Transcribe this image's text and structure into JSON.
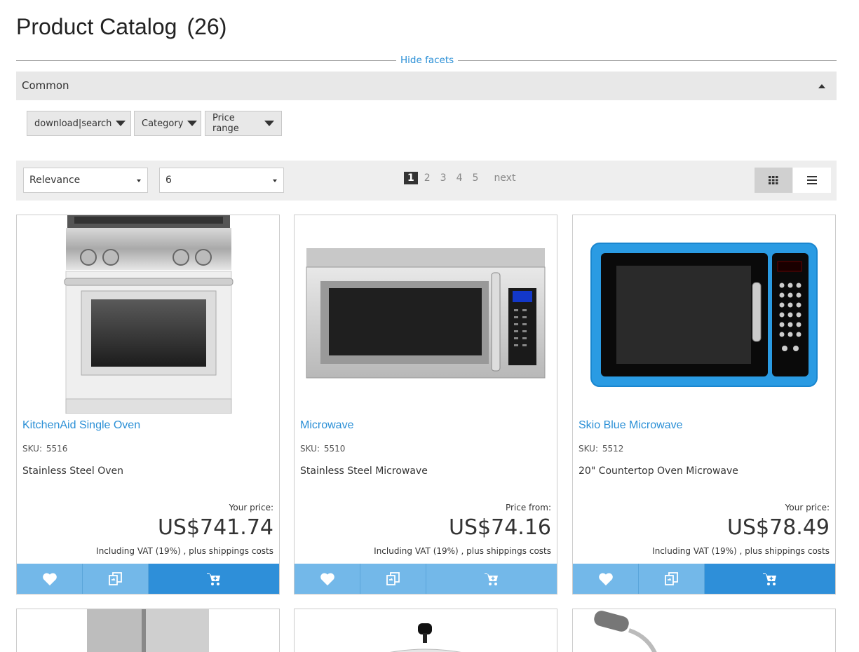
{
  "header": {
    "title": "Product Catalog",
    "count": "(26)"
  },
  "facets": {
    "toggle_label": "Hide facets",
    "group_label": "Common",
    "buttons": [
      "download|search",
      "Category",
      "Price range"
    ]
  },
  "toolbar": {
    "sort_value": "Relevance",
    "per_page_value": "6",
    "pages": [
      "1",
      "2",
      "3",
      "4",
      "5"
    ],
    "next_label": "next",
    "current_page": "1"
  },
  "products": [
    {
      "name": "KitchenAid Single Oven",
      "sku_label": "SKU:",
      "sku": "5516",
      "description": "Stainless Steel Oven",
      "price_label": "Your price:",
      "price": "US$741.74",
      "vat": "Including VAT (19%) , plus shippings costs",
      "image": "oven-image"
    },
    {
      "name": "Microwave",
      "sku_label": "SKU:",
      "sku": "5510",
      "description": "Stainless Steel Microwave",
      "price_label": "Price from:",
      "price": "US$74.16",
      "vat": "Including VAT (19%) , plus shippings costs",
      "image": "microwave-image"
    },
    {
      "name": "Skio Blue Microwave",
      "sku_label": "SKU:",
      "sku": "5512",
      "description": "20\" Countertop Oven Microwave",
      "price_label": "Your price:",
      "price": "US$78.49",
      "vat": "Including VAT (19%) , plus shippings costs",
      "image": "blue-microwave-image"
    }
  ],
  "icons": {
    "favorite": "heart-icon",
    "compare": "compare-icon",
    "cart": "add-to-cart-icon",
    "grid_view": "grid-view-icon",
    "list_view": "list-view-icon"
  },
  "colors": {
    "link": "#2a8fd6",
    "action_light": "#73b8e9",
    "action_dark": "#2e8fd9",
    "toolbar_bg": "#eeeeee"
  }
}
